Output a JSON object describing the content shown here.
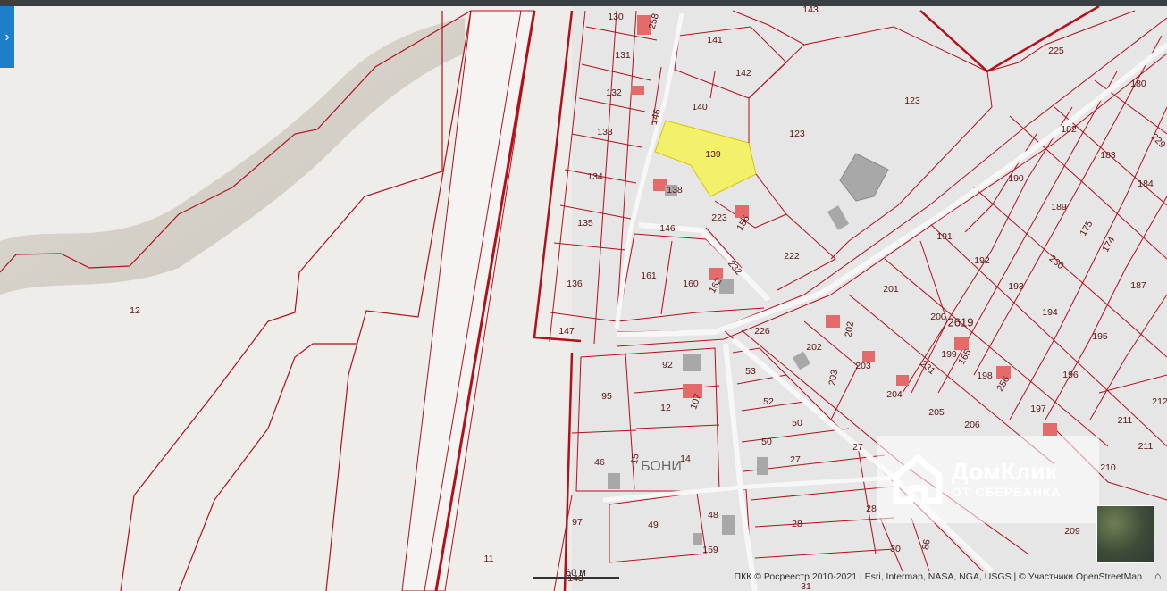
{
  "map": {
    "panel_toggle_icon": "chevron-right-icon",
    "highlight_color": "#f3f06a",
    "boundary_color": "#b3101a",
    "highlighted_parcel": "139",
    "locality": "БОНИ",
    "cadastral_block": "2619",
    "labels": {
      "p130": "130",
      "p131": "131",
      "p132": "132",
      "p133": "133",
      "p134": "134",
      "p135": "135",
      "p136": "136",
      "p147": "147",
      "p141": "141",
      "p142": "142",
      "p143": "143",
      "p140": "140",
      "p139": "139",
      "p138": "138",
      "p123": "123",
      "p225": "225",
      "p180": "180",
      "p182": "182",
      "p183": "183",
      "p184": "184",
      "p190": "190",
      "p189": "189",
      "p175": "175",
      "p174": "174",
      "p187": "187",
      "p191": "191",
      "p192": "192",
      "p193": "193",
      "p194": "194",
      "p195": "195",
      "p196": "196",
      "p197": "197",
      "p201": "201",
      "p200": "200",
      "p199": "199",
      "p198": "198",
      "p205": "205",
      "p206": "206",
      "p204": "204",
      "p203": "203",
      "p202": "202",
      "p202b": "202",
      "p226": "226",
      "p223": "223",
      "p156": "156",
      "p222": "222",
      "p161": "161",
      "p160": "160",
      "p162": "162",
      "p146a": "146",
      "p146b": "146",
      "p258": "258",
      "p232": "232",
      "p230": "230",
      "p231": "231",
      "p229": "229",
      "p165": "165",
      "p256": "256",
      "p92": "92",
      "p95": "95",
      "p12": "12",
      "p107": "107",
      "p53": "53",
      "p52": "52",
      "p50a": "50",
      "p50b": "50",
      "p27a": "27",
      "p27b": "27",
      "p46": "46",
      "p14": "14",
      "p15": "15",
      "p97": "97",
      "p49": "49",
      "p48": "48",
      "p159": "159",
      "p28a": "28",
      "p28b": "28",
      "p30": "30",
      "p86": "86",
      "p209": "209",
      "p210": "210",
      "p211a": "211",
      "p211b": "211",
      "p212": "212",
      "p31": "31",
      "p143b": "143",
      "p12big": "12",
      "p11": "11"
    }
  },
  "watermark": {
    "brand": "ДомКлик",
    "subtitle": "ОТ СБЕРБАНКА"
  },
  "scale": {
    "label": "60 м"
  },
  "attribution": "ПКК © Росреестр 2010-2021 | Esri, Intermap, NASA, NGA, USGS | © Участники OpenStreetMap"
}
